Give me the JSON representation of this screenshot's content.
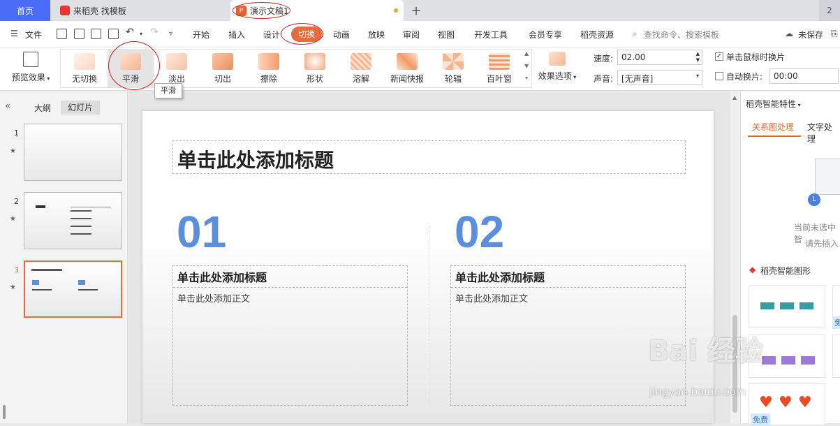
{
  "tabs": {
    "home": "首页",
    "doc": "来稻壳 找模板",
    "ppt": "演示文稿1",
    "right": "2"
  },
  "menu": {
    "file": "文件",
    "items": [
      "开始",
      "插入",
      "设计",
      "切换",
      "动画",
      "放映",
      "审阅",
      "视图",
      "开发工具",
      "会员专享",
      "稻壳资源"
    ],
    "search_placeholder": "查找命令、搜索模板",
    "unsaved": "未保存"
  },
  "ribbon": {
    "preview": "预览效果",
    "gallery": [
      "无切换",
      "平滑",
      "淡出",
      "切出",
      "擦除",
      "形状",
      "溶解",
      "新闻快报",
      "轮辐",
      "百叶窗"
    ],
    "options": "效果选项",
    "speed_label": "速度:",
    "speed_value": "02.00",
    "sound_label": "声音:",
    "sound_value": "[无声音]",
    "click_switch": "单击鼠标时换片",
    "auto_switch": "自动换片:",
    "auto_value": "00:00"
  },
  "tooltip": "平滑",
  "left_panel": {
    "tab_outline": "大纲",
    "tab_slides": "幻灯片",
    "slide_numbers": [
      "1",
      "2",
      "3"
    ]
  },
  "slide": {
    "title": "单击此处添加标题",
    "num1": "01",
    "num2": "02",
    "sub1": "单击此处添加标题",
    "body1": "单击此处添加正文",
    "sub2": "单击此处添加标题",
    "body2": "单击此处添加正文"
  },
  "right_panel": {
    "header": "稻壳智能特性",
    "tab1": "关系图处理",
    "tab2": "文字处理",
    "empty1": "当前未选中智",
    "empty2": "请先插入",
    "section": "稻壳智能图形",
    "free": "免费",
    "free2": "免"
  },
  "watermark": {
    "main": "Bai 经验",
    "sub": "jingyan.baidu.com"
  },
  "colors": {
    "accent": "#e96a3c",
    "number_blue": "#5c8ee0",
    "home_tab": "#4a6cf7"
  }
}
